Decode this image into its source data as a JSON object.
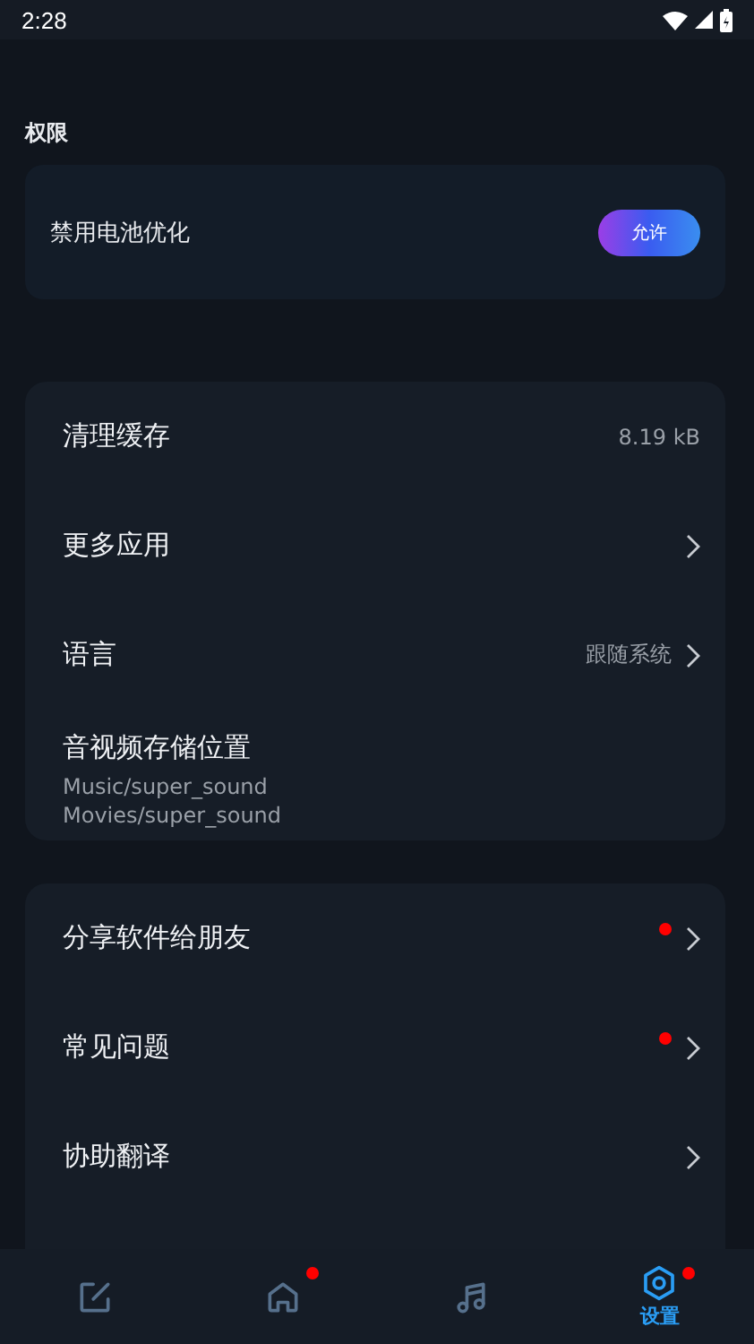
{
  "status_bar": {
    "time": "2:28"
  },
  "permissions": {
    "title": "权限",
    "items": [
      {
        "label": "禁用电池优化",
        "button": "允许"
      }
    ]
  },
  "general": [
    {
      "kind": "value",
      "label": "清理缓存",
      "value": "8.19 kB"
    },
    {
      "kind": "arrow",
      "label": "更多应用"
    },
    {
      "kind": "arrow",
      "label": "语言",
      "value": "跟随系统"
    },
    {
      "kind": "paths",
      "label": "音视频存储位置",
      "lines": [
        "Music/super_sound",
        "Movies/super_sound"
      ]
    }
  ],
  "about": [
    {
      "kind": "arrow",
      "label": "分享软件给朋友",
      "badge": true
    },
    {
      "kind": "arrow",
      "label": "常见问题",
      "badge": true
    },
    {
      "kind": "arrow",
      "label": "协助翻译",
      "badge": false
    }
  ],
  "nav": [
    {
      "kind": "edit",
      "selected": false,
      "badge": false
    },
    {
      "kind": "home",
      "selected": false,
      "badge": true
    },
    {
      "kind": "music",
      "selected": false,
      "badge": false
    },
    {
      "kind": "settings",
      "selected": true,
      "badge": true,
      "label": "设置"
    }
  ]
}
